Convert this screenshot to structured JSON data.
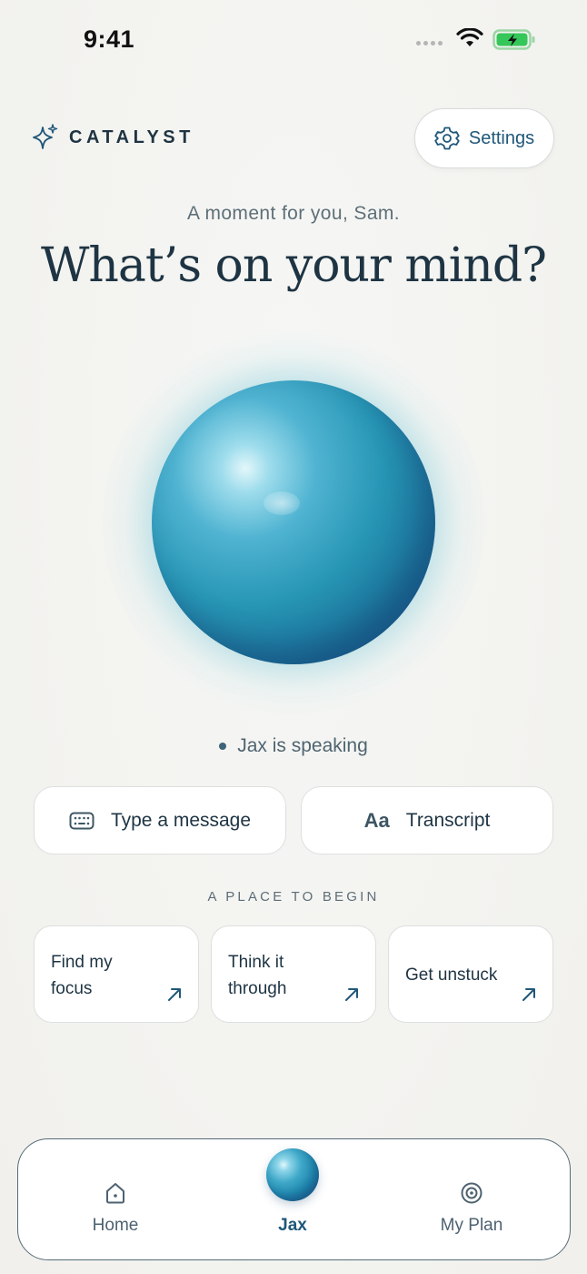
{
  "status_bar": {
    "time": "9:41"
  },
  "header": {
    "brand": "CATALYST",
    "settings_label": "Settings"
  },
  "hero": {
    "greeting": "A moment for you, Sam.",
    "headline": "What’s on your mind?",
    "status": "Jax is speaking"
  },
  "actions": {
    "type_message": "Type a message",
    "transcript_glyph": "Aa",
    "transcript": "Transcript"
  },
  "suggestions": {
    "section_label": "A PLACE TO BEGIN",
    "items": [
      {
        "line1": "Find my",
        "line2": "focus"
      },
      {
        "line1": "Think it",
        "line2": "through"
      },
      {
        "line1": "Get unstuck"
      }
    ]
  },
  "nav": {
    "items": [
      {
        "label": "Home"
      },
      {
        "label": "Jax",
        "active": true
      },
      {
        "label": "My Plan"
      }
    ]
  },
  "colors": {
    "accent": "#1f5779",
    "ink": "#1e3443",
    "battery": "#35c759",
    "background": "#f3f3f0"
  },
  "icons": [
    "sparkle-icon",
    "gear-icon",
    "keyboard-icon",
    "arrow-up-right-icon",
    "home-icon",
    "target-icon",
    "wifi-icon",
    "battery-icon"
  ]
}
